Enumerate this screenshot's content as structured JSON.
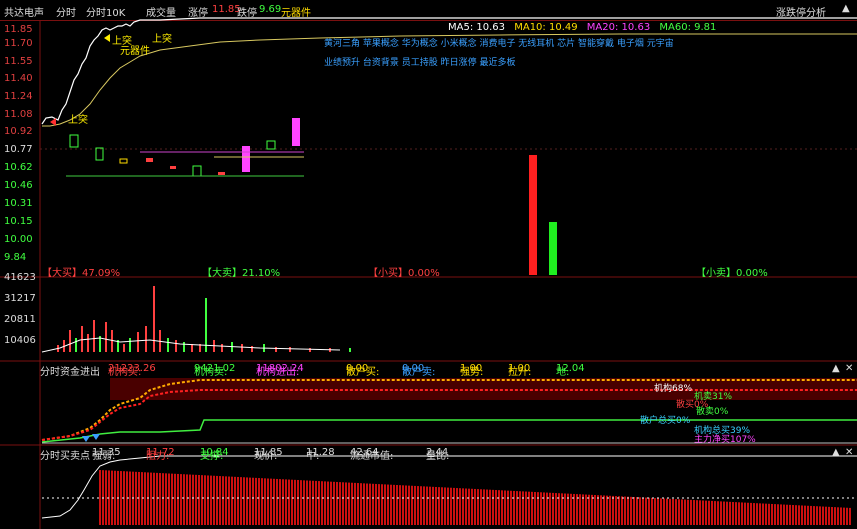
{
  "header": {
    "stock_name": "共达电声",
    "mode": "分时",
    "period": "分时10K",
    "indicator": "成交量",
    "rise_label": "涨停",
    "rise_value": "11.85",
    "fall_label": "跌停",
    "fall_value": "9.69",
    "sector": "元器件",
    "right_button": "涨跌停分析"
  },
  "price_axis": {
    "labels": [
      "11.85",
      "11.70",
      "11.55",
      "11.40",
      "11.24",
      "11.08",
      "10.92",
      "10.77",
      "10.62",
      "10.46",
      "10.31",
      "10.15",
      "10.00",
      "9.84"
    ],
    "current": "10.77"
  },
  "ma": {
    "ma5_label": "MA5:",
    "ma5_value": "10.63",
    "ma10_label": "MA10:",
    "ma10_value": "10.49",
    "ma20_label": "MA20:",
    "ma20_value": "10.63",
    "ma60_label": "MA60:",
    "ma60_value": "9.81",
    "colors": {
      "ma5": "#ffffff",
      "ma10": "#ffdd00",
      "ma20": "#ff44ff",
      "ma60": "#44ff44"
    }
  },
  "concept_tags": {
    "line1": "黄河三角  苹果概念  华为概念  小米概念  消费电子  无线耳机  芯片  智能穿戴  电子烟  元宇宙",
    "line2": "业绩预升  台资背景  员工持股  昨日涨停  最近多板"
  },
  "chart_annotations": {
    "breakout_top": "上突",
    "breakout_left": "上突",
    "breakout_mid": "上突",
    "sector_note": "元器件"
  },
  "flow_bars": {
    "big_buy_label": "【大买】",
    "big_buy_value": "47.09%",
    "big_sell_label": "【大卖】",
    "big_sell_value": "21.10%",
    "small_buy_label": "【小买】",
    "small_buy_value": "0.00%",
    "small_sell_label": "【小卖】",
    "small_sell_value": "0.00%"
  },
  "volume_axis": {
    "labels": [
      "41623",
      "31217",
      "20811",
      "10406"
    ]
  },
  "fund_pane": {
    "title": "分时资金进出",
    "inst_buy_label": "机构买:",
    "inst_buy_value": "21223.26",
    "inst_sell_label": "机构卖:",
    "inst_sell_value": "9421.02",
    "inst_net_label": "机构进出:",
    "inst_net_value": "11802.24",
    "retail_buy_label": "散户买:",
    "retail_buy_value": "0.00",
    "retail_sell_label": "散户卖:",
    "retail_sell_value": "0.00",
    "strength_label": "强势:",
    "strength_value": "1.00",
    "pull_label": "拉升:",
    "pull_value": "1.00",
    "ground_label": "地:",
    "ground_value": "12.04",
    "legend": {
      "l1": "机构68%",
      "l2": "机卖31%",
      "l3": "散买0%",
      "l4": "散卖0%",
      "l5": "散户总买0%",
      "l6": "机构总买39%",
      "l7": "主力净买107%"
    }
  },
  "trade_pane": {
    "title": "分时买卖点",
    "strong_label": "强弱:",
    "strong_value": "11.35",
    "resist_label": "阻力:",
    "resist_value": "11.72",
    "support_label": "支撑:",
    "support_value": "10.84",
    "price_label": "现价:",
    "price_value": "11.85",
    "mid_label": "中:",
    "mid_value": "11.28",
    "cap_label": "流通市值:",
    "cap_value": "42.64",
    "ratio_label": "量比:",
    "ratio_value": "2.44"
  },
  "icons": {
    "pane_close": "close-icon",
    "pane_expand": "triangle-icon"
  }
}
